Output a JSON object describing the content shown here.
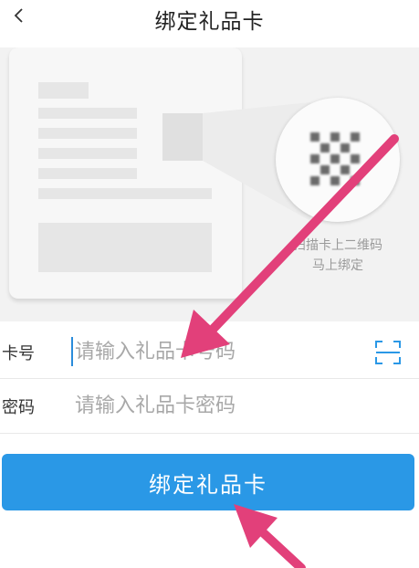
{
  "header": {
    "title": "绑定礼品卡",
    "back_icon": "chevron-left-icon"
  },
  "illustration": {
    "hint_line1": "扫描卡上二维码",
    "hint_line2": "马上绑定"
  },
  "form": {
    "card_number": {
      "label": "卡号",
      "placeholder": "请输入礼品卡号码",
      "value": "",
      "scan_icon": "scan-icon"
    },
    "password": {
      "label": "密码",
      "placeholder": "请输入礼品卡密码",
      "value": ""
    }
  },
  "submit": {
    "label": "绑定礼品卡"
  },
  "colors": {
    "accent": "#2a98e6",
    "annotation_arrow": "#e2407a"
  }
}
